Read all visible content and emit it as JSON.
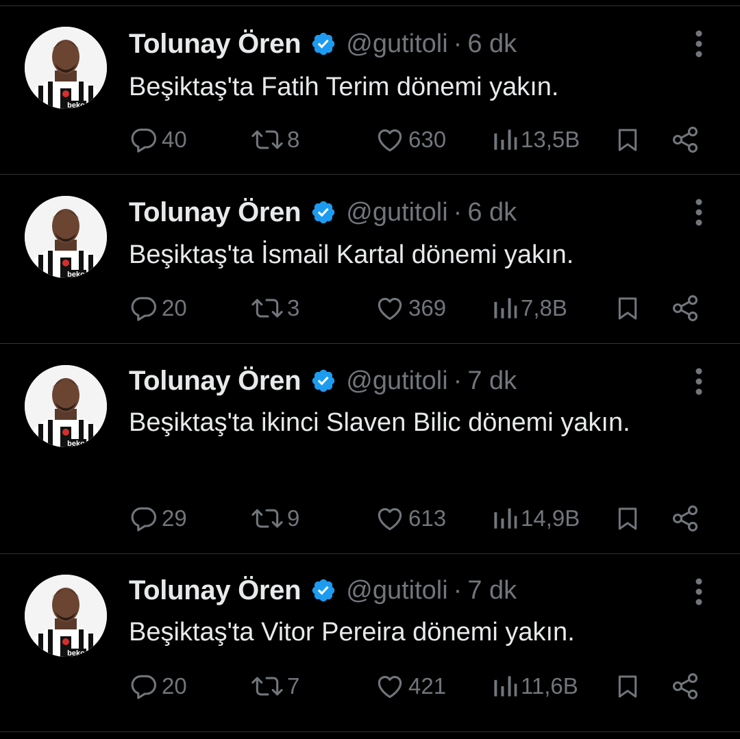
{
  "tweets": [
    {
      "name": "Tolunay Ören",
      "handle": "@gutitoli",
      "separator": "·",
      "time": "6 dk",
      "text": "Beşiktaş'ta Fatih Terim dönemi yakın.",
      "replies": "40",
      "retweets": "8",
      "likes": "630",
      "views": "13,5B"
    },
    {
      "name": "Tolunay Ören",
      "handle": "@gutitoli",
      "separator": "·",
      "time": "6 dk",
      "text": "Beşiktaş'ta İsmail Kartal dönemi yakın.",
      "replies": "20",
      "retweets": "3",
      "likes": "369",
      "views": "7,8B"
    },
    {
      "name": "Tolunay Ören",
      "handle": "@gutitoli",
      "separator": "·",
      "time": "7 dk",
      "text": "Beşiktaş'ta ikinci Slaven Bilic dönemi yakın.",
      "replies": "29",
      "retweets": "9",
      "likes": "613",
      "views": "14,9B"
    },
    {
      "name": "Tolunay Ören",
      "handle": "@gutitoli",
      "separator": "·",
      "time": "7 dk",
      "text": "Beşiktaş'ta Vitor Pereira dönemi yakın.",
      "replies": "20",
      "retweets": "7",
      "likes": "421",
      "views": "11,6B"
    }
  ],
  "avatar": {
    "sponsor_text": "beko"
  },
  "icons": {
    "verified": "verified-badge-icon",
    "more": "more-options-icon",
    "reply": "reply-icon",
    "retweet": "retweet-icon",
    "like": "like-icon",
    "views": "views-icon",
    "bookmark": "bookmark-icon",
    "share": "share-icon"
  },
  "colors": {
    "background": "#000000",
    "text": "#e7e9ea",
    "muted": "#71767b",
    "divider": "#2f3336",
    "verified": "#1d9bf0"
  }
}
